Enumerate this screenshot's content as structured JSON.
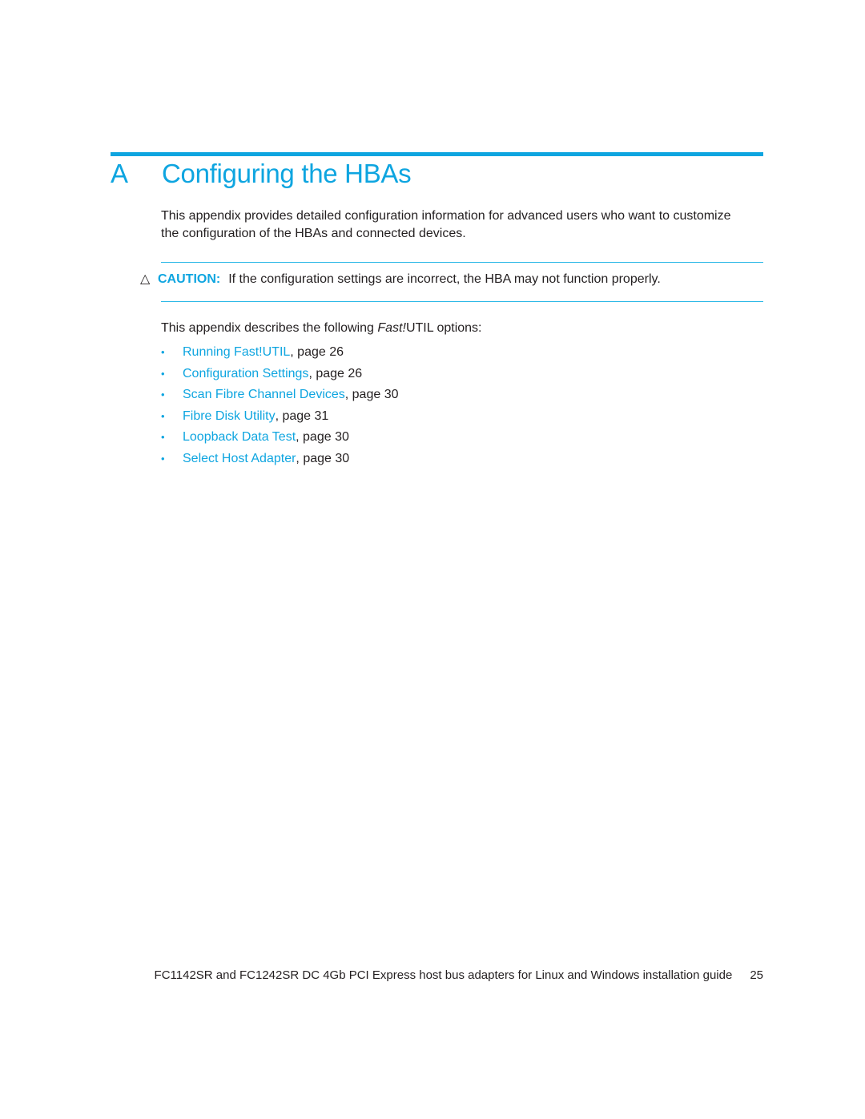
{
  "chapter": {
    "letter": "A",
    "title": "Configuring the HBAs"
  },
  "intro": "This appendix provides detailed configuration information for advanced users who want to customize the configuration of the HBAs and connected devices.",
  "caution": {
    "icon": "warning-triangle-icon",
    "glyph": "△",
    "label": "CAUTION:",
    "text": "If the configuration settings are incorrect, the HBA may not function properly."
  },
  "options_intro": {
    "before": "This appendix describes the following ",
    "emphasis": "Fast!",
    "after": "UTIL options:"
  },
  "options": [
    {
      "link": "Running Fast!UTIL",
      "suffix": ", page 26"
    },
    {
      "link": "Configuration Settings",
      "suffix": ", page 26"
    },
    {
      "link": "Scan Fibre Channel Devices",
      "suffix": ", page 30"
    },
    {
      "link": "Fibre Disk Utility",
      "suffix": ", page 31"
    },
    {
      "link": "Loopback Data Test",
      "suffix": ", page 30"
    },
    {
      "link": "Select Host Adapter",
      "suffix": ", page 30"
    }
  ],
  "bullet_glyph": "•",
  "footer": {
    "title": "FC1142SR and FC1242SR DC 4Gb PCI Express host bus adapters for Linux and Windows installation guide",
    "page_number": "25"
  },
  "colors": {
    "accent": "#0ea5e0",
    "text": "#231f20",
    "rule": "#2bb8e6"
  }
}
